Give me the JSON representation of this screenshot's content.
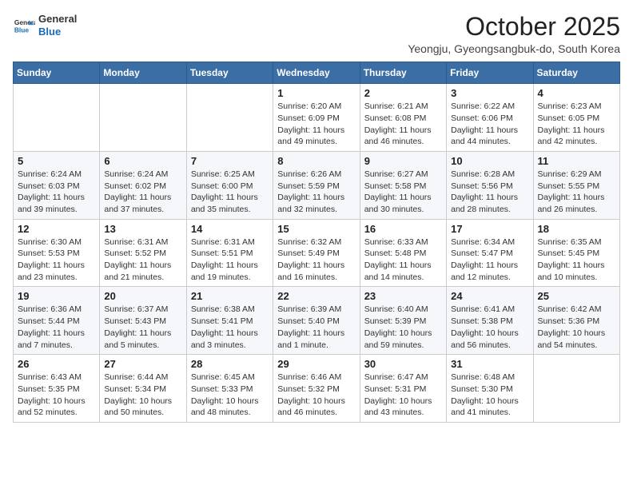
{
  "header": {
    "logo_line1": "General",
    "logo_line2": "Blue",
    "month_title": "October 2025",
    "subtitle": "Yeongju, Gyeongsangbuk-do, South Korea"
  },
  "days_of_week": [
    "Sunday",
    "Monday",
    "Tuesday",
    "Wednesday",
    "Thursday",
    "Friday",
    "Saturday"
  ],
  "weeks": [
    [
      {
        "day": "",
        "info": ""
      },
      {
        "day": "",
        "info": ""
      },
      {
        "day": "",
        "info": ""
      },
      {
        "day": "1",
        "info": "Sunrise: 6:20 AM\nSunset: 6:09 PM\nDaylight: 11 hours and 49 minutes."
      },
      {
        "day": "2",
        "info": "Sunrise: 6:21 AM\nSunset: 6:08 PM\nDaylight: 11 hours and 46 minutes."
      },
      {
        "day": "3",
        "info": "Sunrise: 6:22 AM\nSunset: 6:06 PM\nDaylight: 11 hours and 44 minutes."
      },
      {
        "day": "4",
        "info": "Sunrise: 6:23 AM\nSunset: 6:05 PM\nDaylight: 11 hours and 42 minutes."
      }
    ],
    [
      {
        "day": "5",
        "info": "Sunrise: 6:24 AM\nSunset: 6:03 PM\nDaylight: 11 hours and 39 minutes."
      },
      {
        "day": "6",
        "info": "Sunrise: 6:24 AM\nSunset: 6:02 PM\nDaylight: 11 hours and 37 minutes."
      },
      {
        "day": "7",
        "info": "Sunrise: 6:25 AM\nSunset: 6:00 PM\nDaylight: 11 hours and 35 minutes."
      },
      {
        "day": "8",
        "info": "Sunrise: 6:26 AM\nSunset: 5:59 PM\nDaylight: 11 hours and 32 minutes."
      },
      {
        "day": "9",
        "info": "Sunrise: 6:27 AM\nSunset: 5:58 PM\nDaylight: 11 hours and 30 minutes."
      },
      {
        "day": "10",
        "info": "Sunrise: 6:28 AM\nSunset: 5:56 PM\nDaylight: 11 hours and 28 minutes."
      },
      {
        "day": "11",
        "info": "Sunrise: 6:29 AM\nSunset: 5:55 PM\nDaylight: 11 hours and 26 minutes."
      }
    ],
    [
      {
        "day": "12",
        "info": "Sunrise: 6:30 AM\nSunset: 5:53 PM\nDaylight: 11 hours and 23 minutes."
      },
      {
        "day": "13",
        "info": "Sunrise: 6:31 AM\nSunset: 5:52 PM\nDaylight: 11 hours and 21 minutes."
      },
      {
        "day": "14",
        "info": "Sunrise: 6:31 AM\nSunset: 5:51 PM\nDaylight: 11 hours and 19 minutes."
      },
      {
        "day": "15",
        "info": "Sunrise: 6:32 AM\nSunset: 5:49 PM\nDaylight: 11 hours and 16 minutes."
      },
      {
        "day": "16",
        "info": "Sunrise: 6:33 AM\nSunset: 5:48 PM\nDaylight: 11 hours and 14 minutes."
      },
      {
        "day": "17",
        "info": "Sunrise: 6:34 AM\nSunset: 5:47 PM\nDaylight: 11 hours and 12 minutes."
      },
      {
        "day": "18",
        "info": "Sunrise: 6:35 AM\nSunset: 5:45 PM\nDaylight: 11 hours and 10 minutes."
      }
    ],
    [
      {
        "day": "19",
        "info": "Sunrise: 6:36 AM\nSunset: 5:44 PM\nDaylight: 11 hours and 7 minutes."
      },
      {
        "day": "20",
        "info": "Sunrise: 6:37 AM\nSunset: 5:43 PM\nDaylight: 11 hours and 5 minutes."
      },
      {
        "day": "21",
        "info": "Sunrise: 6:38 AM\nSunset: 5:41 PM\nDaylight: 11 hours and 3 minutes."
      },
      {
        "day": "22",
        "info": "Sunrise: 6:39 AM\nSunset: 5:40 PM\nDaylight: 11 hours and 1 minute."
      },
      {
        "day": "23",
        "info": "Sunrise: 6:40 AM\nSunset: 5:39 PM\nDaylight: 10 hours and 59 minutes."
      },
      {
        "day": "24",
        "info": "Sunrise: 6:41 AM\nSunset: 5:38 PM\nDaylight: 10 hours and 56 minutes."
      },
      {
        "day": "25",
        "info": "Sunrise: 6:42 AM\nSunset: 5:36 PM\nDaylight: 10 hours and 54 minutes."
      }
    ],
    [
      {
        "day": "26",
        "info": "Sunrise: 6:43 AM\nSunset: 5:35 PM\nDaylight: 10 hours and 52 minutes."
      },
      {
        "day": "27",
        "info": "Sunrise: 6:44 AM\nSunset: 5:34 PM\nDaylight: 10 hours and 50 minutes."
      },
      {
        "day": "28",
        "info": "Sunrise: 6:45 AM\nSunset: 5:33 PM\nDaylight: 10 hours and 48 minutes."
      },
      {
        "day": "29",
        "info": "Sunrise: 6:46 AM\nSunset: 5:32 PM\nDaylight: 10 hours and 46 minutes."
      },
      {
        "day": "30",
        "info": "Sunrise: 6:47 AM\nSunset: 5:31 PM\nDaylight: 10 hours and 43 minutes."
      },
      {
        "day": "31",
        "info": "Sunrise: 6:48 AM\nSunset: 5:30 PM\nDaylight: 10 hours and 41 minutes."
      },
      {
        "day": "",
        "info": ""
      }
    ]
  ]
}
